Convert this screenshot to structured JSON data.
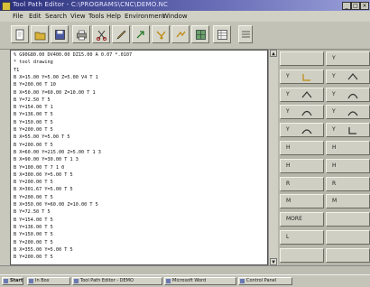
{
  "window": {
    "title": "Tool Path Editor  -  C:\\PROGRAMS\\CNC\\DEMO.NC",
    "controls": [
      "_",
      "□",
      "×"
    ]
  },
  "menu": [
    "File",
    "Edit",
    "Search",
    "View",
    "Tools",
    "Help",
    "Environment",
    "Window"
  ],
  "toolbar": {
    "buttons": [
      {
        "name": "new",
        "icon": "new-file-icon"
      },
      {
        "name": "open",
        "icon": "open-folder-icon"
      },
      {
        "name": "save",
        "icon": "save-icon"
      },
      {
        "name": "print",
        "icon": "printer-icon"
      },
      {
        "name": "cut",
        "icon": "scissors-icon"
      },
      {
        "name": "tool",
        "icon": "pencil-icon"
      },
      {
        "name": "arrow",
        "icon": "arrow-icon"
      },
      {
        "name": "insert",
        "icon": "insert-icon"
      },
      {
        "name": "swap",
        "icon": "swap-icon"
      },
      {
        "name": "grid",
        "icon": "grid-icon"
      },
      {
        "name": "table",
        "icon": "table-icon"
      }
    ]
  },
  "editor": {
    "lines": [
      "%  G90G80.00 DV400.00 DZ15.00 A  0.07 *.0107",
      "*  tool drawing",
      "T1",
      "B    X=15.00 Y=5.00 Z=5.00 V4 T 1",
      "B    Y=200.00 T 10",
      "B    X=50.00 Y=60.00 Z=10.00 T 1",
      "B    Y=72.50 T 5",
      "B    Y=154.00 T 1",
      "B    Y=136.00 T 5",
      "B    Y=150.00 T 5",
      "B    Y=200.00 T 5",
      "B    X=55.00 Y=5.00 T 5",
      "B    Y=200.00 T 5",
      "B    X=60.00 Y=215.00 Z=5.00 T 1 3",
      "B    X=90.00 Y=30.00 T 1 3",
      "B    Y=100.00 T 7 1 0",
      "B    X=300.00 Y=5.00 T 5",
      "B    Y=200.00 T 5",
      "B    X=301.67 Y=5.00 T 5",
      "B    Y=200.00 T 5",
      "B    X=350.00 Y=60.00 Z=10.00 T 5",
      "B    Y=72.50 T 5",
      "B    Y=154.00 T 5",
      "B    Y=136.00 T 5",
      "B    Y=150.00 T 5",
      "B    Y=200.00 T 5",
      "B    X=355.00 Y=5.00 T 5",
      "B    Y=200.00 T 5"
    ]
  },
  "panel": {
    "rows": [
      [
        "",
        "Y"
      ],
      [
        "Y",
        "Y"
      ],
      [
        "Y",
        "Y"
      ],
      [
        "Y",
        "Y"
      ],
      [
        "Y",
        "Y"
      ],
      [
        "H",
        "H"
      ],
      [
        "H",
        "H"
      ],
      [
        "R",
        "R"
      ],
      [
        "M",
        "M"
      ],
      [
        "MORE",
        ""
      ],
      [
        "L",
        ""
      ],
      [
        "",
        ""
      ]
    ]
  },
  "taskbar": {
    "start": "Start",
    "items": [
      "In Box",
      "Tool Path Editor - DEMO",
      "Microsoft Word",
      "Control Panel"
    ]
  },
  "colors": {
    "title_gradient_start": "#2a2f7a",
    "editor_bg": "#ffffff",
    "panel_bg": "#b6b6aa"
  }
}
